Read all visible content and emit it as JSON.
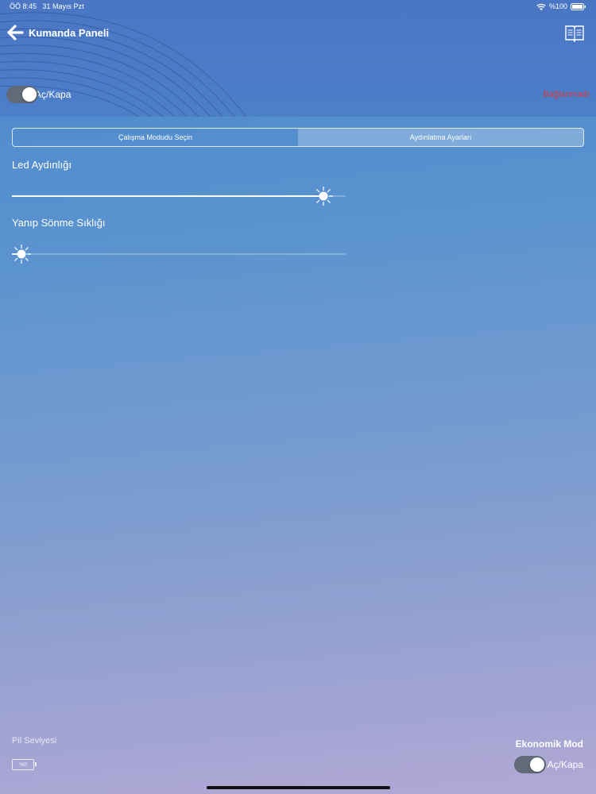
{
  "status_bar": {
    "time": "ÖÖ 8:45",
    "date": "31 Mayıs Pzt",
    "battery": "%100"
  },
  "header": {
    "back_icon": "arrow-left-icon",
    "title": "Kumanda Paneli",
    "book_icon": "book-icon"
  },
  "power": {
    "label": "Aç/Kapa",
    "on": true
  },
  "connection": {
    "status": "Bağlanmadı",
    "color": "#d33a3a"
  },
  "tabs": [
    {
      "label": "Çalışma Modudu Seçin",
      "active": false
    },
    {
      "label": "Aydınlatma Ayarları",
      "active": true
    }
  ],
  "led": {
    "label": "Led Aydınlığı",
    "value": 0.96
  },
  "blink": {
    "label": "Yanıp Sönme Sıklığı",
    "value": 0.0
  },
  "battery": {
    "label": "Pil Seviyesi",
    "value": "%0"
  },
  "eco": {
    "label": "Ekonomik Mod",
    "toggle_label": "Aç/Kapa",
    "on": true
  }
}
